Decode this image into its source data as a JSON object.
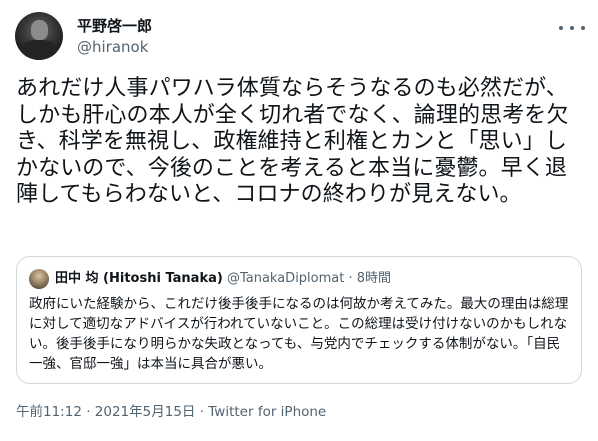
{
  "author": {
    "name": "平野啓一郎",
    "handle": "@hiranok"
  },
  "more_icon": "more-horizontal-icon",
  "tweet_text": "あれだけ人事パワハラ体質ならそうなるのも必然だが、しかも肝心の本人が全く切れ者でなく、論理的思考を欠き、科学を無視し、政権維持と利権とカンと「思い」しかないので、今後のことを考えると本当に憂鬱。早く退陣してもらわないと、コロナの終わりが見えない。",
  "quote": {
    "name": "田中 均 (Hitoshi Tanaka)",
    "handle": "@TanakaDiplomat",
    "separator": " · ",
    "time": "8時間",
    "text": "政府にいた経験から、これだけ後手後手になるのは何故か考えてみた。最大の理由は総理に対して適切なアドバイスが行われていないこと。この総理は受け付けないのかもしれない。後手後手になり明らかな失政となっても、与党内でチェックする体制がない。「自民一強、官邸一強」は本当に具合が悪い。"
  },
  "footer": {
    "time": "午前11:12",
    "separator1": " · ",
    "date": "2021年5月15日",
    "separator2": " · ",
    "source": "Twitter for iPhone"
  },
  "colors": {
    "text": "#0f1419",
    "secondary": "#536471",
    "border": "#cfd9de",
    "background": "#ffffff"
  }
}
